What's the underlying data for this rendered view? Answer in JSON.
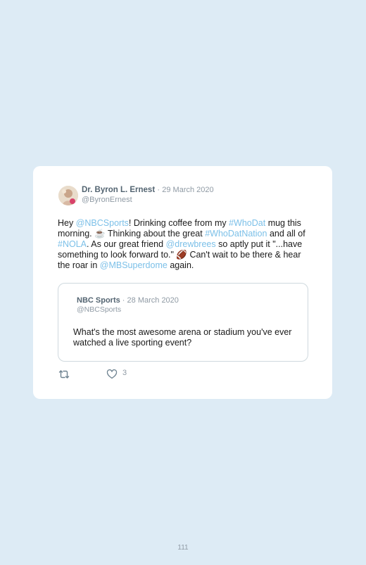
{
  "tweet": {
    "author_name": "Dr. Byron L. Ernest",
    "separator": "·",
    "date": "29 March 2020",
    "handle": "@ByronErnest",
    "body": [
      {
        "t": "Hey ",
        "hl": false
      },
      {
        "t": "@NBCSports",
        "hl": true
      },
      {
        "t": "! Drinking coffee from my ",
        "hl": false
      },
      {
        "t": "#WhoDat",
        "hl": true
      },
      {
        "t": " mug this morning. ☕ Thinking about the great ",
        "hl": false
      },
      {
        "t": "#WhoDatNation",
        "hl": true
      },
      {
        "t": " and all of ",
        "hl": false
      },
      {
        "t": "#NOLA",
        "hl": true
      },
      {
        "t": ". As our great friend ",
        "hl": false
      },
      {
        "t": "@drewbrees",
        "hl": true
      },
      {
        "t": " so aptly put it \"...have something to look forward to.\" 🏈 Can't wait to be there & hear the roar in ",
        "hl": false
      },
      {
        "t": "@MBSuperdome",
        "hl": true
      },
      {
        "t": " again.",
        "hl": false
      }
    ],
    "like_count": "3"
  },
  "quoted": {
    "author_name": "NBC Sports",
    "separator": "·",
    "date": "28 March 2020",
    "handle": "@NBCSports",
    "text": "What's the most awesome arena or stadium you've ever watched a live sporting event?"
  },
  "icons": {
    "retweet": "retweet-icon",
    "like": "heart-icon"
  },
  "colors": {
    "background": "#ddebf5",
    "card": "#ffffff",
    "link": "#7cc0e8",
    "muted": "#8f9aa4"
  },
  "page_number": "111"
}
